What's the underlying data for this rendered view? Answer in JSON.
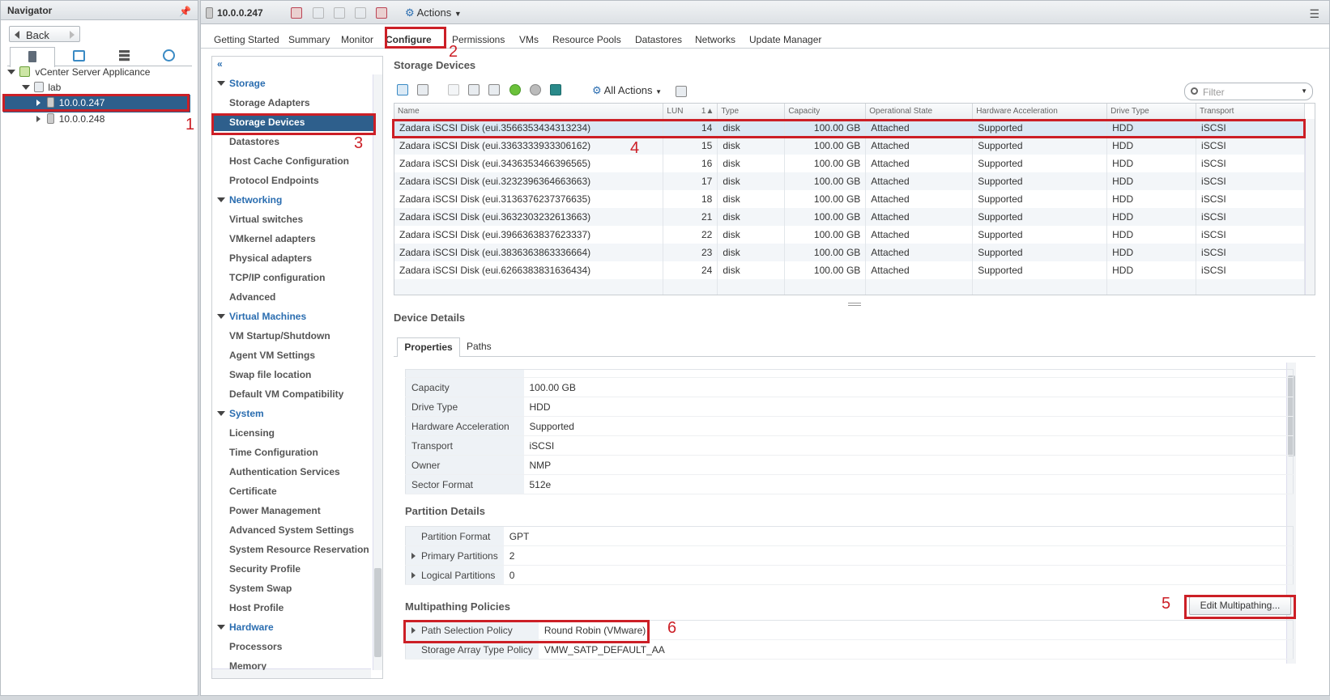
{
  "navigator": {
    "title": "Navigator",
    "back_label": "Back",
    "tree": {
      "root": "vCenter Server Applicance",
      "datacenter": "lab",
      "host1": "10.0.0.247",
      "host2": "10.0.0.248"
    }
  },
  "header": {
    "host": "10.0.0.247",
    "actions_label": "Actions"
  },
  "tabs": [
    "Getting Started",
    "Summary",
    "Monitor",
    "Configure",
    "Permissions",
    "VMs",
    "Resource Pools",
    "Datastores",
    "Networks",
    "Update Manager"
  ],
  "menu": {
    "storage": {
      "title": "Storage",
      "items": [
        "Storage Adapters",
        "Storage Devices",
        "Datastores",
        "Host Cache Configuration",
        "Protocol Endpoints"
      ]
    },
    "networking": {
      "title": "Networking",
      "items": [
        "Virtual switches",
        "VMkernel adapters",
        "Physical adapters",
        "TCP/IP configuration",
        "Advanced"
      ]
    },
    "vms": {
      "title": "Virtual Machines",
      "items": [
        "VM Startup/Shutdown",
        "Agent VM Settings",
        "Swap file location",
        "Default VM Compatibility"
      ]
    },
    "system": {
      "title": "System",
      "items": [
        "Licensing",
        "Time Configuration",
        "Authentication Services",
        "Certificate",
        "Power Management",
        "Advanced System Settings",
        "System Resource Reservation",
        "Security Profile",
        "System Swap",
        "Host Profile"
      ]
    },
    "hardware": {
      "title": "Hardware",
      "items": [
        "Processors",
        "Memory"
      ]
    }
  },
  "storage_devices": {
    "title": "Storage Devices",
    "all_actions": "All Actions",
    "filter_placeholder": "Filter",
    "columns": [
      "Name",
      "LUN",
      "1",
      "Type",
      "Capacity",
      "Operational State",
      "Hardware Acceleration",
      "Drive Type",
      "Transport"
    ],
    "rows": [
      {
        "name": "Zadara iSCSI Disk (eui.3566353434313234)",
        "lun": "14",
        "type": "disk",
        "capacity": "100.00 GB",
        "state": "Attached",
        "accel": "Supported",
        "drive": "HDD",
        "transport": "iSCSI"
      },
      {
        "name": "Zadara iSCSI Disk (eui.3363333933306162)",
        "lun": "15",
        "type": "disk",
        "capacity": "100.00 GB",
        "state": "Attached",
        "accel": "Supported",
        "drive": "HDD",
        "transport": "iSCSI"
      },
      {
        "name": "Zadara iSCSI Disk (eui.3436353466396565)",
        "lun": "16",
        "type": "disk",
        "capacity": "100.00 GB",
        "state": "Attached",
        "accel": "Supported",
        "drive": "HDD",
        "transport": "iSCSI"
      },
      {
        "name": "Zadara iSCSI Disk (eui.3232396364663663)",
        "lun": "17",
        "type": "disk",
        "capacity": "100.00 GB",
        "state": "Attached",
        "accel": "Supported",
        "drive": "HDD",
        "transport": "iSCSI"
      },
      {
        "name": "Zadara iSCSI Disk (eui.3136376237376635)",
        "lun": "18",
        "type": "disk",
        "capacity": "100.00 GB",
        "state": "Attached",
        "accel": "Supported",
        "drive": "HDD",
        "transport": "iSCSI"
      },
      {
        "name": "Zadara iSCSI Disk (eui.3632303232613663)",
        "lun": "21",
        "type": "disk",
        "capacity": "100.00 GB",
        "state": "Attached",
        "accel": "Supported",
        "drive": "HDD",
        "transport": "iSCSI"
      },
      {
        "name": "Zadara iSCSI Disk (eui.3966363837623337)",
        "lun": "22",
        "type": "disk",
        "capacity": "100.00 GB",
        "state": "Attached",
        "accel": "Supported",
        "drive": "HDD",
        "transport": "iSCSI"
      },
      {
        "name": "Zadara iSCSI Disk (eui.3836363863336664)",
        "lun": "23",
        "type": "disk",
        "capacity": "100.00 GB",
        "state": "Attached",
        "accel": "Supported",
        "drive": "HDD",
        "transport": "iSCSI"
      },
      {
        "name": "Zadara iSCSI Disk (eui.6266383831636434)",
        "lun": "24",
        "type": "disk",
        "capacity": "100.00 GB",
        "state": "Attached",
        "accel": "Supported",
        "drive": "HDD",
        "transport": "iSCSI"
      }
    ]
  },
  "device_details": {
    "title": "Device Details",
    "tab_properties": "Properties",
    "tab_paths": "Paths",
    "properties": [
      {
        "k": "Capacity",
        "v": "100.00 GB"
      },
      {
        "k": "Drive Type",
        "v": "HDD"
      },
      {
        "k": "Hardware Acceleration",
        "v": "Supported"
      },
      {
        "k": "Transport",
        "v": "iSCSI"
      },
      {
        "k": "Owner",
        "v": "NMP"
      },
      {
        "k": "Sector Format",
        "v": "512e"
      }
    ],
    "partition_title": "Partition Details",
    "partition": [
      {
        "k": "Partition Format",
        "v": "GPT"
      },
      {
        "k": "Primary Partitions",
        "v": "2"
      },
      {
        "k": "Logical Partitions",
        "v": "0"
      }
    ],
    "multipath_title": "Multipathing Policies",
    "edit_multipathing": "Edit Multipathing...",
    "multipath": [
      {
        "k": "Path Selection Policy",
        "v": "Round Robin (VMware)"
      },
      {
        "k": "Storage Array Type Policy",
        "v": "VMW_SATP_DEFAULT_AA"
      }
    ]
  },
  "annotations": [
    "1",
    "2",
    "3",
    "4",
    "5",
    "6"
  ]
}
